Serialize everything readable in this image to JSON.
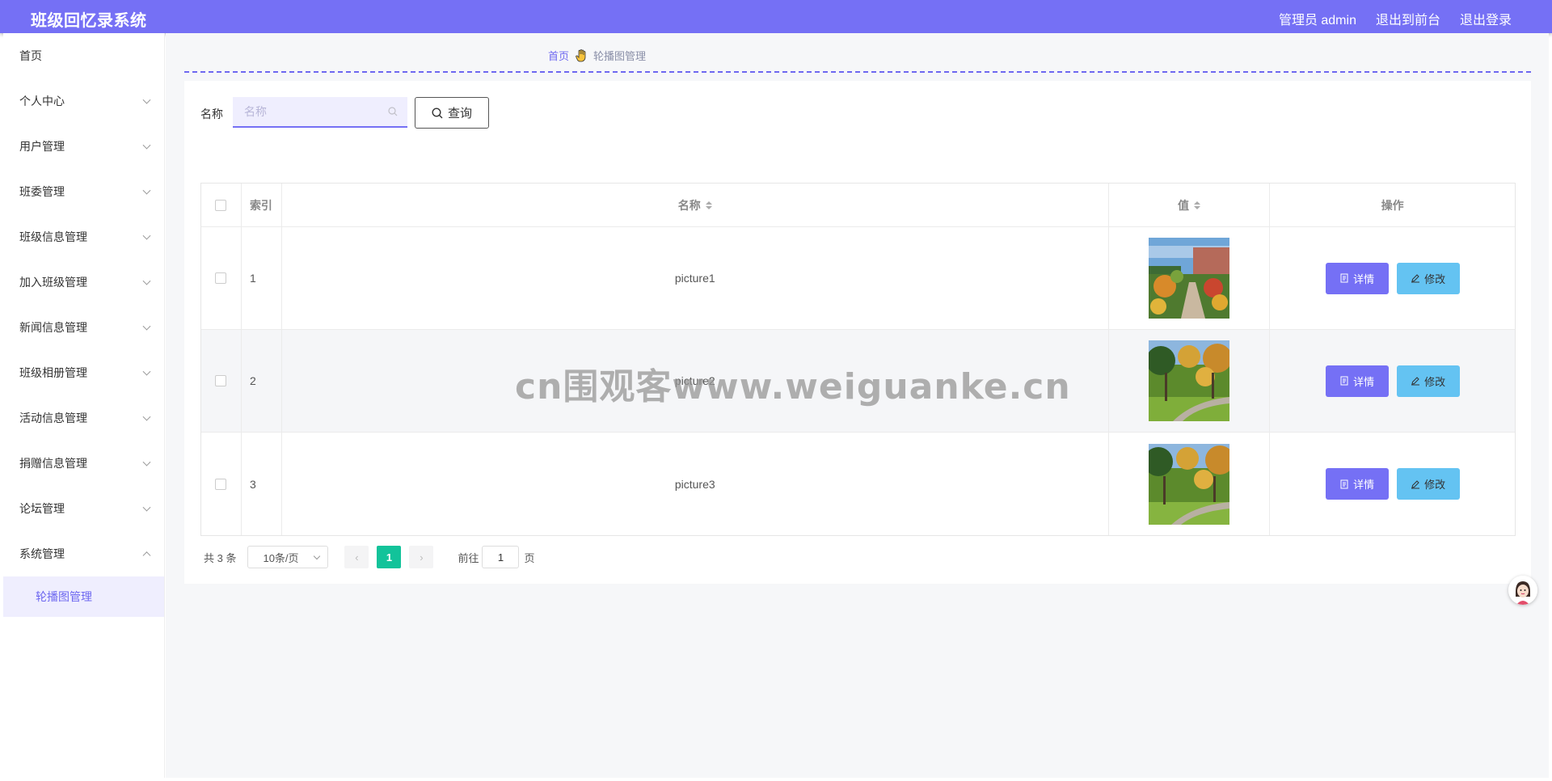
{
  "header": {
    "app_title": "班级回忆录系统",
    "user_label": "管理员 admin",
    "front_link": "退出到前台",
    "logout_link": "退出登录"
  },
  "sidebar": {
    "items": [
      {
        "label": "首页",
        "icon": "none"
      },
      {
        "label": "个人中心",
        "icon": "chevron-down-icon"
      },
      {
        "label": "用户管理",
        "icon": "chevron-down-icon"
      },
      {
        "label": "班委管理",
        "icon": "chevron-down-icon"
      },
      {
        "label": "班级信息管理",
        "icon": "chevron-down-icon"
      },
      {
        "label": "加入班级管理",
        "icon": "chevron-down-icon"
      },
      {
        "label": "新闻信息管理",
        "icon": "chevron-down-icon"
      },
      {
        "label": "班级相册管理",
        "icon": "chevron-down-icon"
      },
      {
        "label": "活动信息管理",
        "icon": "chevron-down-icon"
      },
      {
        "label": "捐赠信息管理",
        "icon": "chevron-down-icon"
      },
      {
        "label": "论坛管理",
        "icon": "chevron-down-icon"
      },
      {
        "label": "系统管理",
        "icon": "chevron-up-icon"
      }
    ],
    "sub_items": [
      {
        "label": "轮播图管理"
      }
    ]
  },
  "breadcrumb": {
    "home": "首页",
    "current": "轮播图管理"
  },
  "search": {
    "label": "名称",
    "placeholder": "名称",
    "button": "查询"
  },
  "table": {
    "headers": {
      "index": "索引",
      "name": "名称",
      "value": "值",
      "actions": "操作"
    },
    "rows": [
      {
        "index": "1",
        "name": "picture1",
        "image": "campus-photo-1"
      },
      {
        "index": "2",
        "name": "picture2",
        "image": "campus-photo-2"
      },
      {
        "index": "3",
        "name": "picture3",
        "image": "campus-photo-3"
      }
    ],
    "detail_label": "详情",
    "edit_label": "修改"
  },
  "pagination": {
    "total": "共 3 条",
    "page_size": "10条/页",
    "current_page": "1",
    "goto_label": "前往",
    "goto_value": "1",
    "page_suffix": "页"
  },
  "watermark": "cn围观客www.weiguanke.cn",
  "colors": {
    "primary": "#7570f5",
    "edit_button": "#64c3f2",
    "active_page": "#12c39a"
  }
}
